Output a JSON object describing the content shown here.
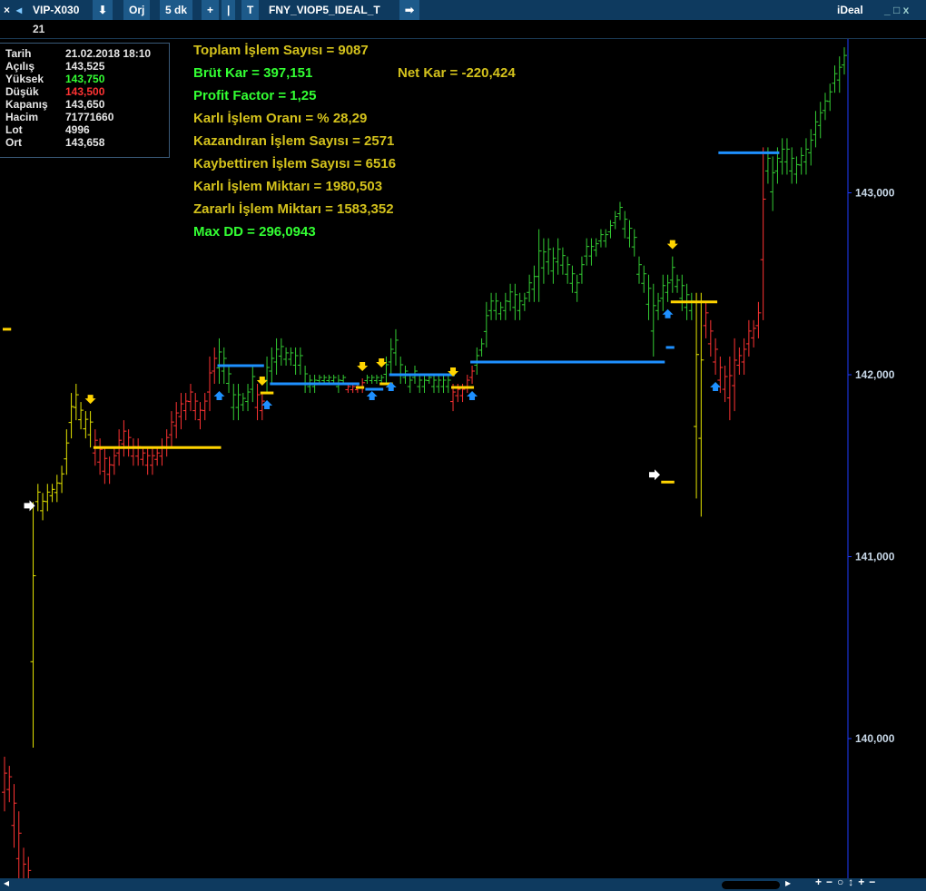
{
  "toolbar": {
    "symbol": "VIP-X030",
    "mode": "Orj",
    "period": "5 dk",
    "system": "FNY_VIOP5_IDEAL_T",
    "brand": "iDeal",
    "window_controls": "_ □ x"
  },
  "subbar": {
    "value": "21"
  },
  "info": [
    {
      "key": "Tarih",
      "value": "21.02.2018 18:10",
      "color": "#e6e6e6"
    },
    {
      "key": "Açılış",
      "value": "143,525",
      "color": "#e6e6e6"
    },
    {
      "key": "Yüksek",
      "value": "143,750",
      "color": "#33ff33"
    },
    {
      "key": "Düşük",
      "value": "143,500",
      "color": "#ff3333"
    },
    {
      "key": "Kapanış",
      "value": "143,650",
      "color": "#e6e6e6"
    },
    {
      "key": "Hacim",
      "value": "71771660",
      "color": "#e6e6e6"
    },
    {
      "key": "Lot",
      "value": "4996",
      "color": "#e6e6e6"
    },
    {
      "key": "Ort",
      "value": "143,658",
      "color": "#e6e6e6"
    }
  ],
  "stats": {
    "toplam": "Toplam İşlem Sayısı =  9087",
    "brut": "Brüt Kar =  397,151",
    "net": "Net Kar =  -220,424",
    "pf": "Profit Factor =  1,25",
    "oran": "Karlı İşlem Oranı = % 28,29",
    "kazandiran": "Kazandıran İşlem Sayısı =  2571",
    "kaybettiren": "Kaybettiren İşlem Sayısı =  6516",
    "karli_miktar": "Karlı İşlem Miktarı =  1980,503",
    "zararli_miktar": "Zararlı İşlem Miktarı =  1583,352",
    "maxdd": "Max DD = 296,0943"
  },
  "colors": {
    "gold": "#d4c21c",
    "green_text": "#33ff33",
    "up_bar": "#33cc33",
    "down_bar": "#ff3333",
    "neutral_bar": "#e6e600",
    "sell_level": "#ffd400",
    "buy_level": "#1e90ff",
    "axis_text": "#c8d8e8"
  },
  "chart_data": {
    "type": "ohlc",
    "y_ticks": [
      "143,000",
      "142,000",
      "141,000",
      "140,000"
    ],
    "y_tick_values": [
      143.0,
      142.0,
      141.0,
      140.0
    ],
    "ylim": [
      139.25,
      144.15
    ],
    "grid": false,
    "segments": [
      {
        "color": "red",
        "hl": [
          [
            139.9,
            139.6
          ],
          [
            139.85,
            139.65
          ],
          [
            139.75,
            139.4
          ],
          [
            139.6,
            139.2
          ],
          [
            139.4,
            139.1
          ],
          [
            139.35,
            139.1
          ]
        ]
      },
      {
        "color": "yellow",
        "hl": [
          [
            141.3,
            139.95
          ],
          [
            141.4,
            141.25
          ],
          [
            141.35,
            141.2
          ],
          [
            141.4,
            141.25
          ],
          [
            141.4,
            141.3
          ],
          [
            141.45,
            141.3
          ],
          [
            141.5,
            141.35
          ],
          [
            141.7,
            141.45
          ],
          [
            141.9,
            141.65
          ],
          [
            141.95,
            141.75
          ],
          [
            141.85,
            141.7
          ],
          [
            141.8,
            141.65
          ],
          [
            141.8,
            141.6
          ]
        ]
      },
      {
        "color": "red",
        "hl": [
          [
            141.7,
            141.5
          ],
          [
            141.65,
            141.45
          ],
          [
            141.6,
            141.4
          ],
          [
            141.55,
            141.4
          ],
          [
            141.6,
            141.45
          ],
          [
            141.7,
            141.5
          ],
          [
            141.75,
            141.55
          ],
          [
            141.7,
            141.55
          ],
          [
            141.65,
            141.5
          ],
          [
            141.65,
            141.5
          ],
          [
            141.6,
            141.5
          ],
          [
            141.6,
            141.45
          ],
          [
            141.6,
            141.45
          ],
          [
            141.6,
            141.5
          ],
          [
            141.65,
            141.5
          ],
          [
            141.7,
            141.55
          ],
          [
            141.8,
            141.6
          ],
          [
            141.85,
            141.65
          ],
          [
            141.9,
            141.7
          ],
          [
            141.9,
            141.75
          ],
          [
            141.95,
            141.8
          ],
          [
            141.9,
            141.75
          ],
          [
            141.85,
            141.7
          ],
          [
            141.9,
            141.75
          ],
          [
            142.1,
            141.8
          ],
          [
            142.15,
            141.95
          ]
        ]
      },
      {
        "color": "green",
        "hl": [
          [
            142.2,
            141.95
          ],
          [
            142.15,
            141.95
          ],
          [
            142.05,
            141.9
          ],
          [
            141.95,
            141.75
          ],
          [
            141.95,
            141.75
          ],
          [
            141.9,
            141.8
          ],
          [
            141.95,
            141.8
          ],
          [
            142.05,
            141.85
          ]
        ]
      },
      {
        "color": "red",
        "hl": [
          [
            141.95,
            141.75
          ],
          [
            141.9,
            141.75
          ]
        ]
      },
      {
        "color": "green",
        "hl": [
          [
            142.1,
            141.9
          ],
          [
            142.15,
            141.95
          ],
          [
            142.2,
            142.0
          ],
          [
            142.2,
            142.05
          ],
          [
            142.15,
            142.05
          ],
          [
            142.15,
            142.05
          ],
          [
            142.15,
            142.0
          ],
          [
            142.15,
            142.0
          ],
          [
            142.05,
            141.9
          ],
          [
            142.0,
            141.9
          ],
          [
            142.0,
            141.9
          ],
          [
            142.0,
            141.95
          ],
          [
            142.0,
            141.95
          ],
          [
            142.0,
            141.95
          ],
          [
            142.0,
            141.95
          ],
          [
            142.0,
            141.9
          ],
          [
            142.0,
            141.95
          ]
        ]
      },
      {
        "color": "red",
        "hl": [
          [
            141.95,
            141.9
          ],
          [
            141.95,
            141.9
          ],
          [
            141.95,
            141.9
          ],
          [
            141.98,
            141.9
          ]
        ]
      },
      {
        "color": "green",
        "hl": [
          [
            142.0,
            141.95
          ],
          [
            142.0,
            141.95
          ],
          [
            142.0,
            141.95
          ],
          [
            142.0,
            141.95
          ],
          [
            142.1,
            141.95
          ],
          [
            142.2,
            142.0
          ],
          [
            142.25,
            142.05
          ],
          [
            142.1,
            141.95
          ],
          [
            142.05,
            141.95
          ],
          [
            142.0,
            141.9
          ],
          [
            142.05,
            141.95
          ],
          [
            142.0,
            141.9
          ],
          [
            142.0,
            141.9
          ],
          [
            142.0,
            141.95
          ],
          [
            142.0,
            141.9
          ],
          [
            142.0,
            141.9
          ],
          [
            142.0,
            141.9
          ],
          [
            142.0,
            141.9
          ]
        ]
      },
      {
        "color": "red",
        "hl": [
          [
            141.95,
            141.8
          ],
          [
            141.95,
            141.85
          ],
          [
            141.95,
            141.85
          ],
          [
            142.0,
            141.9
          ],
          [
            142.05,
            141.95
          ]
        ]
      },
      {
        "color": "green",
        "hl": [
          [
            142.15,
            142.0
          ],
          [
            142.2,
            142.1
          ],
          [
            142.4,
            142.15
          ],
          [
            142.45,
            142.3
          ],
          [
            142.45,
            142.3
          ],
          [
            142.4,
            142.3
          ],
          [
            142.45,
            142.3
          ],
          [
            142.5,
            142.35
          ],
          [
            142.5,
            142.3
          ],
          [
            142.45,
            142.3
          ],
          [
            142.45,
            142.35
          ],
          [
            142.55,
            142.4
          ],
          [
            142.6,
            142.4
          ],
          [
            142.8,
            142.4
          ],
          [
            142.75,
            142.5
          ],
          [
            142.75,
            142.55
          ],
          [
            142.7,
            142.5
          ],
          [
            142.75,
            142.55
          ],
          [
            142.7,
            142.55
          ],
          [
            142.65,
            142.5
          ],
          [
            142.6,
            142.45
          ],
          [
            142.55,
            142.4
          ],
          [
            142.65,
            142.5
          ],
          [
            142.75,
            142.6
          ],
          [
            142.75,
            142.6
          ],
          [
            142.75,
            142.65
          ],
          [
            142.8,
            142.7
          ],
          [
            142.8,
            142.7
          ],
          [
            142.85,
            142.75
          ],
          [
            142.9,
            142.8
          ],
          [
            142.95,
            142.85
          ],
          [
            142.9,
            142.75
          ],
          [
            142.85,
            142.7
          ],
          [
            142.8,
            142.65
          ],
          [
            142.65,
            142.5
          ],
          [
            142.6,
            142.45
          ],
          [
            142.55,
            142.3
          ],
          [
            142.5,
            142.1
          ],
          [
            142.45,
            142.3
          ],
          [
            142.55,
            142.35
          ],
          [
            142.55,
            142.4
          ],
          [
            142.65,
            142.45
          ],
          [
            142.55,
            142.45
          ],
          [
            142.55,
            142.35
          ],
          [
            142.5,
            142.3
          ],
          [
            142.45,
            142.3
          ]
        ]
      },
      {
        "color": "yellow",
        "hl": [
          [
            142.45,
            141.32
          ],
          [
            142.45,
            141.22
          ]
        ]
      },
      {
        "color": "red",
        "hl": [
          [
            142.4,
            142.2
          ],
          [
            142.3,
            142.1
          ],
          [
            142.2,
            142.0
          ],
          [
            142.1,
            141.9
          ],
          [
            142.05,
            141.85
          ],
          [
            142.1,
            141.75
          ],
          [
            142.2,
            141.8
          ],
          [
            142.15,
            142.0
          ],
          [
            142.2,
            142.0
          ],
          [
            142.3,
            142.1
          ],
          [
            142.3,
            142.15
          ],
          [
            142.4,
            142.2
          ],
          [
            143.25,
            142.3
          ]
        ]
      },
      {
        "color": "green",
        "hl": [
          [
            143.25,
            143.05
          ],
          [
            143.2,
            142.9
          ],
          [
            143.25,
            143.05
          ],
          [
            143.3,
            143.1
          ],
          [
            143.3,
            143.1
          ],
          [
            143.25,
            143.05
          ],
          [
            143.2,
            143.05
          ],
          [
            143.25,
            143.1
          ],
          [
            143.3,
            143.1
          ],
          [
            143.35,
            143.15
          ],
          [
            143.45,
            143.25
          ],
          [
            143.5,
            143.3
          ],
          [
            143.55,
            143.4
          ],
          [
            143.6,
            143.45
          ],
          [
            143.7,
            143.55
          ],
          [
            143.75,
            143.55
          ],
          [
            143.8,
            143.65
          ]
        ]
      }
    ],
    "sell_levels": [
      {
        "price": 142.25,
        "start": 0,
        "end": 1
      },
      {
        "price": 141.6,
        "start": 19,
        "end": 45
      },
      {
        "price": 141.9,
        "start": 54,
        "end": 56
      },
      {
        "price": 141.93,
        "start": 74,
        "end": 75
      },
      {
        "price": 141.95,
        "start": 79,
        "end": 81
      },
      {
        "price": 141.93,
        "start": 94,
        "end": 98
      },
      {
        "price": 141.41,
        "start": 138,
        "end": 140
      },
      {
        "price": 142.4,
        "start": 140,
        "end": 149
      }
    ],
    "buy_levels": [
      {
        "price": 142.05,
        "start": 45,
        "end": 54
      },
      {
        "price": 141.95,
        "start": 56,
        "end": 74
      },
      {
        "price": 141.92,
        "start": 76,
        "end": 79
      },
      {
        "price": 142.0,
        "start": 81,
        "end": 94
      },
      {
        "price": 142.07,
        "start": 98,
        "end": 138
      },
      {
        "price": 142.15,
        "start": 139,
        "end": 140
      },
      {
        "price": 143.22,
        "start": 150,
        "end": 162
      }
    ],
    "sell_arrows": [
      18,
      54,
      75,
      79,
      94,
      140
    ],
    "buy_arrows": [
      45,
      55,
      77,
      81,
      98,
      139,
      149
    ],
    "entry_arrows": [
      {
        "bar": 6,
        "price": 141.28
      },
      {
        "bar": 137,
        "price": 141.45
      }
    ]
  }
}
